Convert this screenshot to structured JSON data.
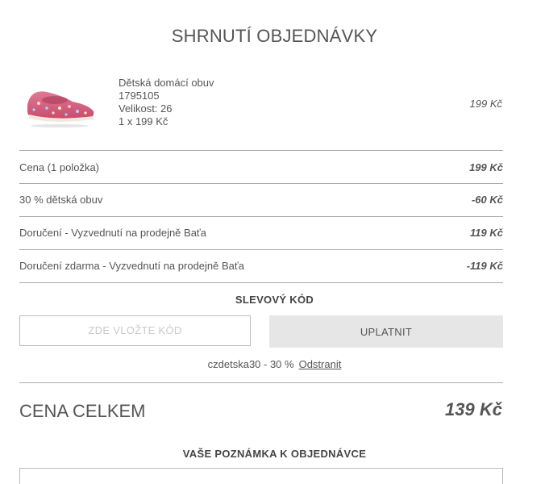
{
  "summary": {
    "title": "SHRNUTÍ OBJEDNÁVKY"
  },
  "product": {
    "name": "Dětská domácí obuv",
    "code": "1795105",
    "size": "Velikost: 26",
    "qty_price": "1 x 199 Kč",
    "price": "199 Kč",
    "image_icon": "pink-slipper-image"
  },
  "lines": [
    {
      "label": "Cena (1 položka)",
      "value": "199 Kč"
    },
    {
      "label": "30 % dětská obuv",
      "value": "-60 Kč"
    },
    {
      "label": "Doručení - Vyzvednutí na prodejně Baťa",
      "value": "119 Kč"
    },
    {
      "label": "Doručení zdarma - Vyzvednutí na prodejně Baťa",
      "value": "-119 Kč"
    }
  ],
  "coupon": {
    "heading": "SLEVOVÝ KÓD",
    "placeholder": "ZDE VLOŽTE KÓD",
    "apply_label": "UPLATNIT",
    "applied_code": "czdetska30 - 30 %",
    "remove_label": "Odstranit"
  },
  "total": {
    "label": "CENA CELKEM",
    "value": "139 Kč"
  },
  "note": {
    "heading": "VAŠE POZNÁMKA K OBJEDNÁVCE"
  },
  "colors": {
    "divider": "#aaaaaa",
    "button_bg": "#e6e6e6",
    "text": "#555555",
    "slipper": "#d9607e"
  }
}
